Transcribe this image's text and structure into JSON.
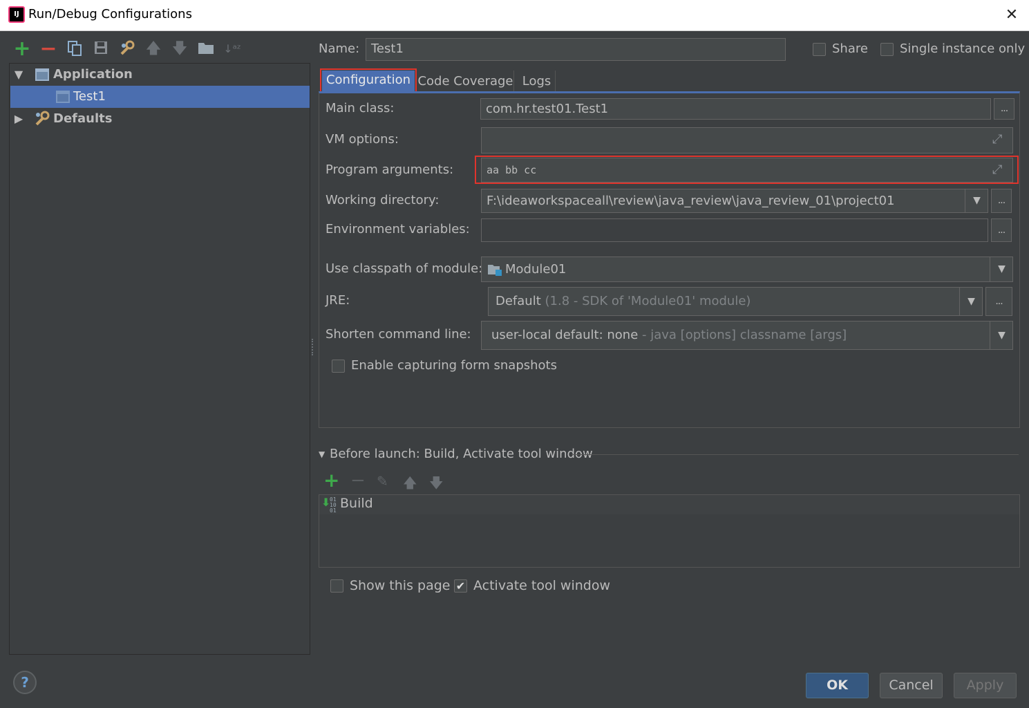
{
  "window": {
    "title": "Run/Debug Configurations",
    "logo": "IJ",
    "close_glyph": "✕"
  },
  "left_toolbar": {
    "icons": [
      "add-icon",
      "remove-icon",
      "copy-icon",
      "save-icon",
      "edit-defaults-icon",
      "move-up-icon",
      "move-down-icon",
      "folder-icon",
      "sort-icon"
    ]
  },
  "tree": {
    "application": {
      "label": "Application",
      "child": "Test1"
    },
    "defaults": {
      "label": "Defaults"
    }
  },
  "header": {
    "name_label": "Name:",
    "name_value": "Test1",
    "share_label": "Share",
    "single_instance_label": "Single instance only"
  },
  "tabs": [
    "Configuration",
    "Code Coverage",
    "Logs"
  ],
  "form": {
    "main_class": {
      "label": "Main class:",
      "value": "com.hr.test01.Test1"
    },
    "vm_options": {
      "label": "VM options:",
      "value": ""
    },
    "program_arguments": {
      "label": "Program arguments:",
      "value": "aa bb cc"
    },
    "working_directory": {
      "label": "Working directory:",
      "value": "F:\\ideaworkspaceall\\review\\java_review\\java_review_01\\project01"
    },
    "environment_variables": {
      "label": "Environment variables:",
      "value": ""
    },
    "classpath_module": {
      "label": "Use classpath of module:",
      "value": "Module01"
    },
    "jre": {
      "label": "JRE:",
      "value": "Default",
      "hint": "(1.8 - SDK of 'Module01' module)"
    },
    "shorten_command_line": {
      "label": "Shorten command line:",
      "value": "user-local default: none",
      "hint": "- java [options] classname [args]"
    },
    "enable_snapshots": {
      "label": "Enable capturing form snapshots",
      "checked": false
    },
    "dots": "..."
  },
  "before_launch": {
    "title": "Before launch: Build, Activate tool window",
    "items": [
      "Build"
    ],
    "show_page_label": "Show this page",
    "show_page_checked": false,
    "activate_label": "Activate tool window",
    "activate_checked": true
  },
  "buttons": {
    "ok": "OK",
    "cancel": "Cancel",
    "apply": "Apply",
    "help": "?"
  },
  "colors": {
    "accent": "#4b6eaf",
    "add_green": "#3ea84b",
    "remove_red": "#d24a3f",
    "highlight_red": "#e0342c"
  }
}
